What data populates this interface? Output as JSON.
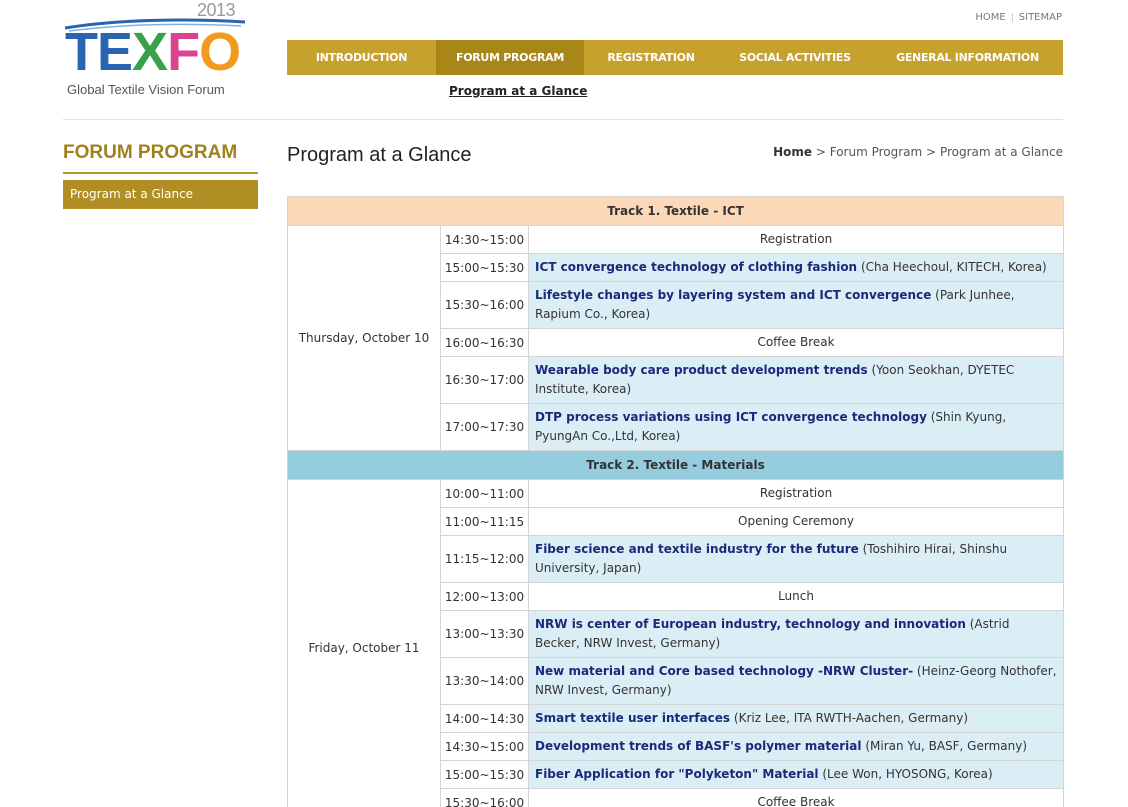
{
  "logo": {
    "year": "2013",
    "word": [
      "T",
      "E",
      "X",
      "F",
      "O"
    ],
    "letter_colors": [
      "#2a63b0",
      "#2a63b0",
      "#3aa14b",
      "#d9438f",
      "#f29a1f"
    ],
    "tagline": "Global Textile Vision Forum"
  },
  "utility": {
    "home": "HOME",
    "sitemap": "SITEMAP"
  },
  "nav": {
    "items": [
      "INTRODUCTION",
      "FORUM PROGRAM",
      "REGISTRATION",
      "SOCIAL ACTIVITIES",
      "GENERAL INFORMATION"
    ],
    "sub_item": "Program at a Glance"
  },
  "sidebar": {
    "title": "FORUM PROGRAM",
    "items": [
      "Program at a Glance"
    ]
  },
  "page": {
    "title": "Program at a Glance",
    "breadcrumb": {
      "home": "Home",
      "sep": ">",
      "level1": "Forum Program",
      "level2": "Program at a Glance"
    }
  },
  "colors": {
    "nav_bg": "#c6a12d",
    "nav_active": "#a98618",
    "track1_bg": "#fbd8b8",
    "track2_bg": "#95cddf",
    "row_bg": "#dceef5",
    "title_text": "#1a2a7a"
  },
  "program": {
    "track1": {
      "title": "Track 1. Textile - ICT",
      "day": "Thursday, October 10",
      "rows": [
        {
          "time": "14:30~15:00",
          "plain": "Registration"
        },
        {
          "time": "15:00~15:30",
          "title": "ICT convergence technology of clothing fashion",
          "speaker": "(Cha Heechoul, KITECH, Korea)"
        },
        {
          "time": "15:30~16:00",
          "title": "Lifestyle changes by layering system and ICT convergence",
          "speaker": "(Park Junhee, Rapium Co., Korea)"
        },
        {
          "time": "16:00~16:30",
          "plain": "Coffee Break"
        },
        {
          "time": "16:30~17:00",
          "title": "Wearable body care product development trends",
          "speaker": "(Yoon Seokhan, DYETEC Institute, Korea)"
        },
        {
          "time": "17:00~17:30",
          "title": "DTP process variations using ICT convergence technology",
          "speaker": "(Shin Kyung, PyungAn Co.,Ltd, Korea)"
        }
      ]
    },
    "track2": {
      "title": "Track 2. Textile - Materials",
      "day": "Friday, October 11",
      "rows": [
        {
          "time": "10:00~11:00",
          "plain": "Registration"
        },
        {
          "time": "11:00~11:15",
          "plain": "Opening Ceremony"
        },
        {
          "time": "11:15~12:00",
          "title": "Fiber science and textile industry for the future",
          "speaker": "(Toshihiro Hirai, Shinshu University, Japan)"
        },
        {
          "time": "12:00~13:00",
          "plain": "Lunch"
        },
        {
          "time": "13:00~13:30",
          "title": "NRW is center of European industry, technology and innovation",
          "speaker": "(Astrid Becker, NRW Invest, Germany)"
        },
        {
          "time": "13:30~14:00",
          "title": "New material and Core based technology -NRW Cluster-",
          "speaker": "(Heinz-Georg Nothofer, NRW Invest, Germany)"
        },
        {
          "time": "14:00~14:30",
          "title": "Smart textile user interfaces",
          "speaker": "(Kriz Lee, ITA RWTH-Aachen, Germany)"
        },
        {
          "time": "14:30~15:00",
          "title": "Development trends of BASF's polymer material",
          "speaker": "(Miran Yu, BASF, Germany)"
        },
        {
          "time": "15:00~15:30",
          "title": "Fiber Application for \"Polyketon\" Material",
          "speaker": "(Lee Won, HYOSONG, Korea)"
        },
        {
          "time": "15:30~16:00",
          "plain": "Coffee Break"
        }
      ]
    }
  }
}
